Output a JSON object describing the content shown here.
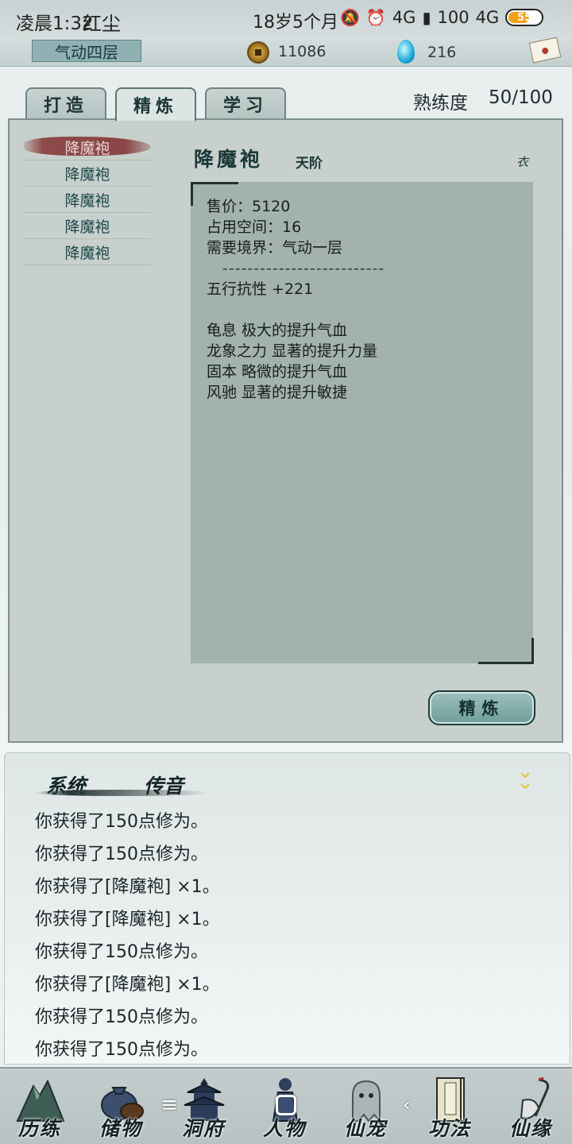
{
  "status_bar": {
    "time": "凌晨1:32",
    "player_name": "红尘",
    "age": "18岁5个月",
    "network": "4G",
    "battery": "55",
    "speed": "100"
  },
  "top_bar": {
    "realm": "气动四层",
    "coins": "11086",
    "gems": "216"
  },
  "tabs": [
    {
      "label": "打造"
    },
    {
      "label": "精炼"
    },
    {
      "label": "学习"
    }
  ],
  "mastery": {
    "label": "熟练度",
    "value": "50/100"
  },
  "item_list": [
    {
      "name": "降魔袍"
    },
    {
      "name": "降魔袍"
    },
    {
      "name": "降魔袍"
    },
    {
      "name": "降魔袍"
    },
    {
      "name": "降魔袍"
    }
  ],
  "detail": {
    "name": "降魔袍",
    "grade": "天阶",
    "type": "衣",
    "price": "售价：5120",
    "space": "占用空间：16",
    "requirement": "需要境界：气动一层",
    "separator": "--------------------------",
    "resistance": "五行抗性 +221",
    "effects": [
      "龟息 极大的提升气血",
      "龙象之力 显著的提升力量",
      "固本 略微的提升气血",
      "风驰 显著的提升敏捷"
    ]
  },
  "refine_button": "精炼",
  "log": {
    "tabs": [
      "系统",
      "传音"
    ],
    "lines": [
      "你获得了150点修为。",
      "你获得了150点修为。",
      "你获得了[降魔袍] ×1。",
      "你获得了[降魔袍] ×1。",
      "你获得了150点修为。",
      "你获得了[降魔袍] ×1。",
      "你获得了150点修为。",
      "你获得了150点修为。"
    ]
  },
  "bottom_nav": [
    {
      "label": "历练",
      "icon": "mountain-icon"
    },
    {
      "label": "储物",
      "icon": "bag-icon"
    },
    {
      "label": "洞府",
      "icon": "pagoda-icon"
    },
    {
      "label": "人物",
      "icon": "figure-icon"
    },
    {
      "label": "仙宠",
      "icon": "ghost-pet-icon"
    },
    {
      "label": "功法",
      "icon": "book-icon"
    },
    {
      "label": "仙缘",
      "icon": "crane-icon"
    }
  ],
  "colors": {
    "accent": "#8fb1b3",
    "panel": "#c7d0cc",
    "detail_box": "#a4b2ad",
    "selected_brush": "#8e4a4a"
  }
}
